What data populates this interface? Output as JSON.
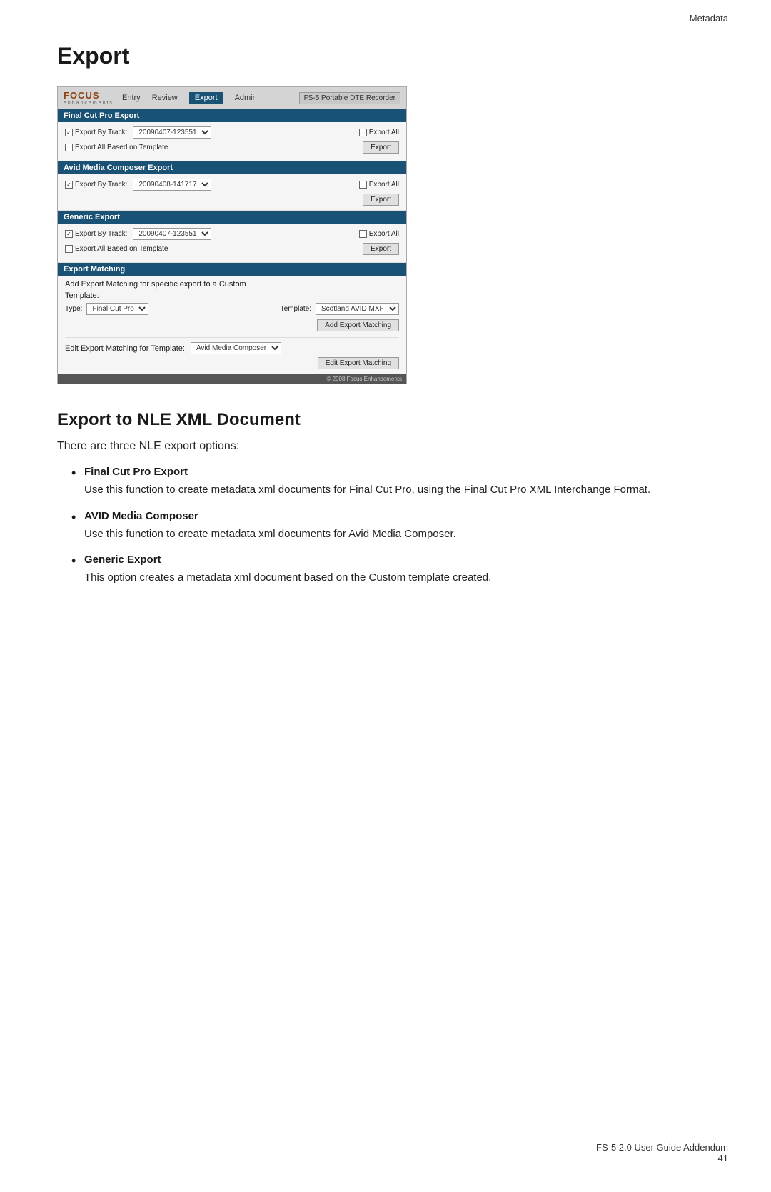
{
  "header": {
    "label": "Metadata"
  },
  "footer": {
    "guide": "FS-5 2.0 User Guide Addendum",
    "page": "41"
  },
  "page_title": "Export",
  "screenshot": {
    "nav": {
      "logo_main": "FOCUS",
      "logo_sub": "enhancements",
      "items": [
        "Entry",
        "Review",
        "Export",
        "Admin"
      ],
      "active": "Export",
      "right_button": "FS-5 Portable DTE Recorder"
    },
    "sections": [
      {
        "id": "final_cut",
        "header": "Final Cut Pro Export",
        "track_label": "Export By Track:",
        "track_value": "20090407-123551",
        "export_all_label": "Export All",
        "template_label": "Export All Based on Template",
        "export_btn": "Export"
      },
      {
        "id": "avid",
        "header": "Avid Media Composer Export",
        "track_label": "Export By Track:",
        "track_value": "20090408-141717",
        "export_all_label": "Export All",
        "template_label": "",
        "export_btn": "Export"
      },
      {
        "id": "generic",
        "header": "Generic Export",
        "track_label": "Export By Track:",
        "track_value": "20090407-123551",
        "export_all_label": "Export All",
        "template_label": "Export All Based on Template",
        "export_btn": "Export"
      }
    ],
    "matching_section": {
      "header": "Export Matching",
      "description": "Add Export Matching for specific export to a Custom",
      "template_label": "Template:",
      "type_label": "Type:",
      "type_value": "Final Cut Pro",
      "template_value_label": "Template:",
      "template_value": "Scotland AVID MXF",
      "add_btn": "Add Export Matching",
      "edit_label": "Edit Export Matching for Template:",
      "edit_type_value": "Avid Media Composer",
      "edit_btn": "Edit Export Matching"
    },
    "footer_text": "© 2008 Focus Enhancements"
  },
  "export_section": {
    "title": "Export to NLE XML Document",
    "intro": "There are three NLE export options:",
    "bullets": [
      {
        "title": "Final Cut Pro Export",
        "desc": "Use this function to create metadata xml documents for Final Cut Pro, using the Final Cut Pro XML Interchange Format."
      },
      {
        "title": "AVID Media Composer",
        "desc": "Use this function to create metadata xml documents for Avid Media Composer."
      },
      {
        "title": "Generic Export",
        "desc": "This option creates a metadata xml document based on the Custom template created."
      }
    ]
  }
}
